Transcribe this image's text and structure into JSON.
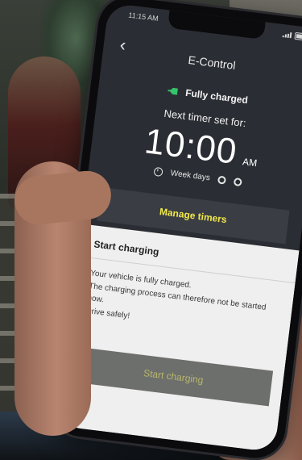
{
  "status_bar": {
    "time": "11:15 AM"
  },
  "header": {
    "back_icon": "chevron-left-icon",
    "title": "E-Control"
  },
  "charging_status": {
    "icon": "plug-icon",
    "label": "Fully charged"
  },
  "timer": {
    "label": "Next timer set for:",
    "time": "10:00",
    "ampm": "AM",
    "days_label": "Week days"
  },
  "manage_timers_button": {
    "label": "Manage timers"
  },
  "sheet": {
    "title": "Start charging",
    "body_lines": [
      "Your vehicle is fully charged.",
      "The charging process can therefore not be started",
      "now.",
      "Drive safely!"
    ],
    "start_button": {
      "label": "Start charging"
    }
  },
  "colors": {
    "accent_yellow": "#f0e84a",
    "plug_green": "#36c26a",
    "screen_bg": "#2a2d33",
    "sheet_bg": "#efefef",
    "disabled_button": "#6d6f6c"
  }
}
